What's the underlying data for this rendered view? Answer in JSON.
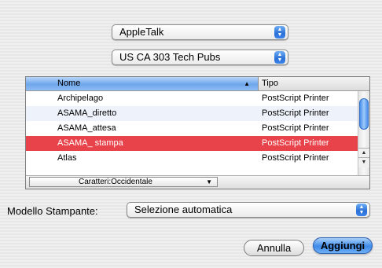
{
  "network_popup": {
    "value": "AppleTalk",
    "arrows": "▲▼"
  },
  "zone_popup": {
    "value": "US CA 303 Tech Pubs",
    "arrows": "▲▼"
  },
  "printer_list": {
    "columns": {
      "name": "Nome",
      "type": "Tipo",
      "sort_indicator": "▲"
    },
    "rows": [
      {
        "name": "Archipelago",
        "type": "PostScript Printer"
      },
      {
        "name": "ASAMA_diretto",
        "type": "PostScript Printer"
      },
      {
        "name": "ASAMA_attesa",
        "type": "PostScript Printer"
      },
      {
        "name": "ASAMA_ stampa",
        "type": "PostScript Printer",
        "selected": true
      },
      {
        "name": "Atlas",
        "type": "PostScript Printer"
      }
    ],
    "charset_popup": "Caratteri:Occidentale",
    "scroll_up": "▲",
    "scroll_down": "▼"
  },
  "printer_model": {
    "label": "Modello Stampante:",
    "value": "Selezione automatica",
    "arrows": "▲▼"
  },
  "buttons": {
    "cancel": "Annulla",
    "add": "Aggiungi"
  },
  "colors": {
    "selection": "#e8434a",
    "accent": "#3e8ae8"
  }
}
